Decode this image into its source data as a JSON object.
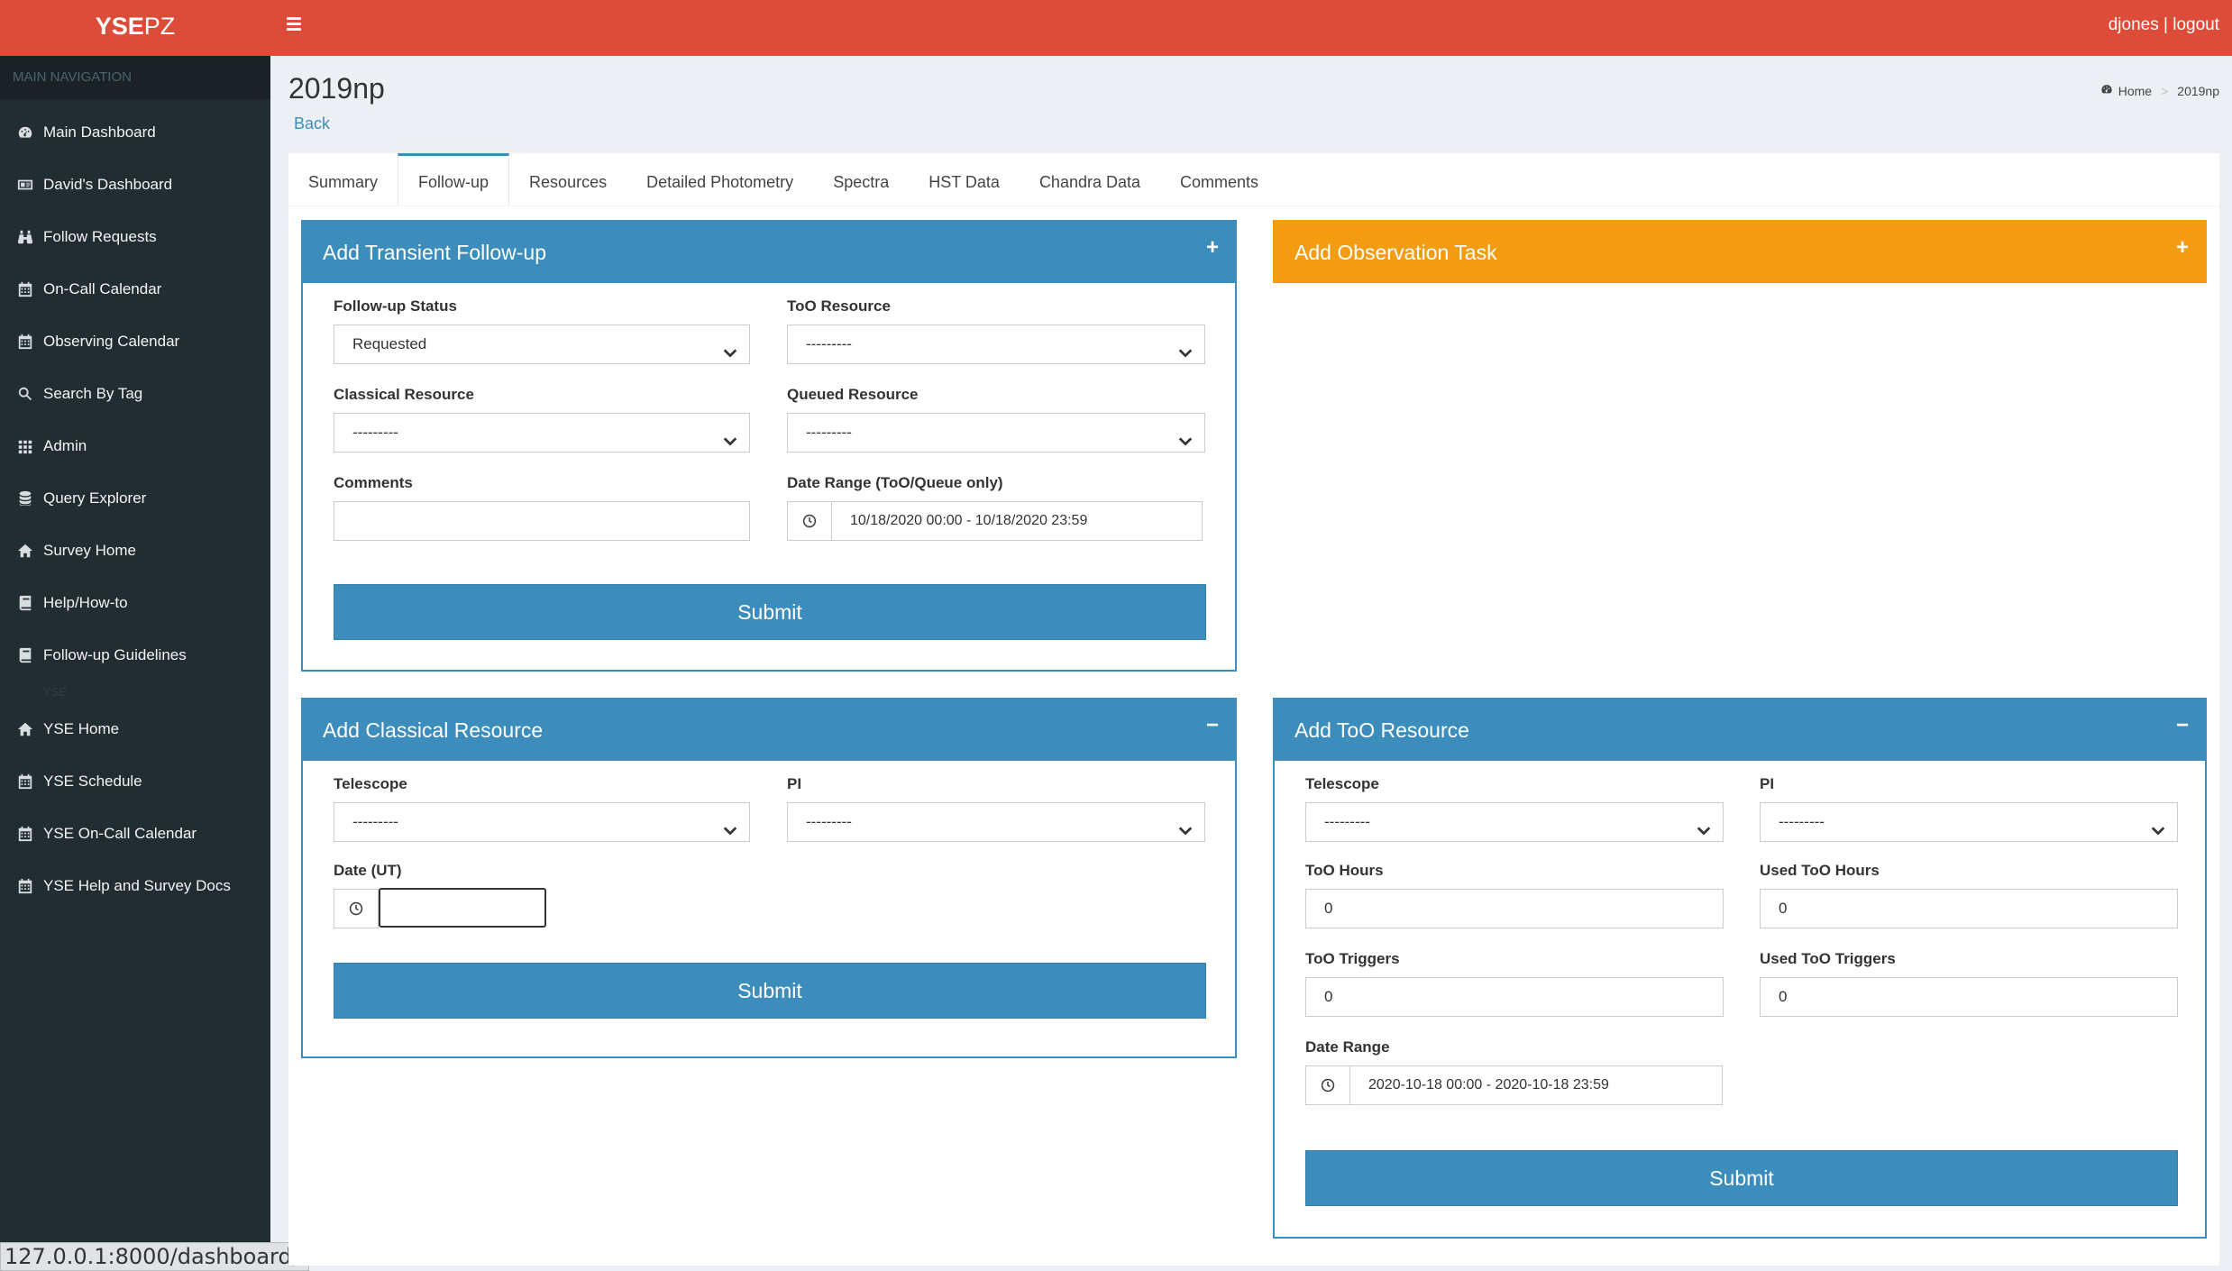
{
  "header": {
    "logo_bold": "YSE",
    "logo_light": "PZ",
    "user": "djones",
    "separator": " | ",
    "logout": "logout"
  },
  "sidebar": {
    "header": "MAIN NAVIGATION",
    "items": [
      {
        "label": "Main Dashboard",
        "icon": "dashboard-icon"
      },
      {
        "label": "David's Dashboard",
        "icon": "id-card-icon"
      },
      {
        "label": "Follow Requests",
        "icon": "binoculars-icon"
      },
      {
        "label": "On-Call Calendar",
        "icon": "calendar-icon"
      },
      {
        "label": "Observing Calendar",
        "icon": "calendar-icon"
      },
      {
        "label": "Search By Tag",
        "icon": "search-icon"
      },
      {
        "label": "Admin",
        "icon": "grid-icon"
      },
      {
        "label": "Query Explorer",
        "icon": "database-icon"
      },
      {
        "label": "Survey Home",
        "icon": "home-icon"
      },
      {
        "label": "Help/How-to",
        "icon": "book-icon"
      },
      {
        "label": "Follow-up Guidelines",
        "icon": "book-icon"
      }
    ],
    "section2_header": "YSE",
    "items2": [
      {
        "label": "YSE Home",
        "icon": "home-icon"
      },
      {
        "label": "YSE Schedule",
        "icon": "calendar-icon"
      },
      {
        "label": "YSE On-Call Calendar",
        "icon": "calendar-icon"
      },
      {
        "label": "YSE Help and Survey Docs",
        "icon": "calendar-icon"
      }
    ]
  },
  "status_url": "127.0.0.1:8000/dashboard/",
  "page": {
    "title": "2019np",
    "back": "Back",
    "breadcrumb": {
      "home": "Home",
      "current": "2019np"
    }
  },
  "tabs": [
    {
      "label": "Summary",
      "active": false
    },
    {
      "label": "Follow-up",
      "active": true
    },
    {
      "label": "Resources",
      "active": false
    },
    {
      "label": "Detailed Photometry",
      "active": false
    },
    {
      "label": "Spectra",
      "active": false
    },
    {
      "label": "HST Data",
      "active": false
    },
    {
      "label": "Chandra Data",
      "active": false
    },
    {
      "label": "Comments",
      "active": false
    }
  ],
  "followup": {
    "title": "Add Transient Follow-up",
    "tool": "+",
    "status_label": "Follow-up Status",
    "status_value": "Requested",
    "too_label": "ToO Resource",
    "too_value": "---------",
    "classical_label": "Classical Resource",
    "classical_value": "---------",
    "queued_label": "Queued Resource",
    "queued_value": "---------",
    "comments_label": "Comments",
    "comments_value": "",
    "daterange_label": "Date Range (ToO/Queue only)",
    "daterange_value": "10/18/2020 00:00 - 10/18/2020 23:59",
    "submit": "Submit"
  },
  "obs_task": {
    "title": "Add Observation Task",
    "tool": "+"
  },
  "classical": {
    "title": "Add Classical Resource",
    "tool": "−",
    "telescope_label": "Telescope",
    "telescope_value": "---------",
    "pi_label": "PI",
    "pi_value": "---------",
    "date_label": "Date (UT)",
    "date_value": "",
    "submit": "Submit"
  },
  "too": {
    "title": "Add ToO Resource",
    "tool": "−",
    "telescope_label": "Telescope",
    "telescope_value": "---------",
    "pi_label": "PI",
    "pi_value": "---------",
    "hours_label": "ToO Hours",
    "hours_value": "0",
    "used_hours_label": "Used ToO Hours",
    "used_hours_value": "0",
    "triggers_label": "ToO Triggers",
    "triggers_value": "0",
    "used_triggers_label": "Used ToO Triggers",
    "used_triggers_value": "0",
    "daterange_label": "Date Range",
    "daterange_value": "2020-10-18 00:00 - 2020-10-18 23:59",
    "submit": "Submit"
  },
  "colors": {
    "header": "#dd4b39",
    "sidebar": "#222d32",
    "primary": "#3c8dbc",
    "warning": "#f39c12",
    "background": "#ecf0f5"
  }
}
